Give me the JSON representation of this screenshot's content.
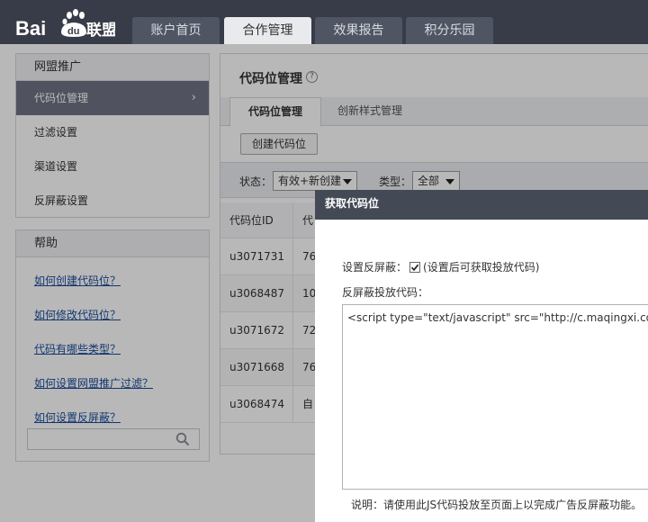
{
  "header": {
    "logo_alt": "Baidu联盟",
    "nav_tabs": [
      {
        "label": "账户首页",
        "active": false
      },
      {
        "label": "合作管理",
        "active": true
      },
      {
        "label": "效果报告",
        "active": false
      },
      {
        "label": "积分乐园",
        "active": false
      }
    ]
  },
  "sidebar": {
    "promo": {
      "heading": "网盟推广",
      "items": [
        {
          "label": "代码位管理",
          "active": true
        },
        {
          "label": "过滤设置",
          "active": false
        },
        {
          "label": "渠道设置",
          "active": false
        },
        {
          "label": "反屏蔽设置",
          "active": false
        }
      ]
    },
    "help": {
      "heading": "帮助",
      "links": [
        "如何创建代码位？",
        "如何修改代码位？",
        "代码有哪些类型？",
        "如何设置网盟推广过滤？",
        "如何设置反屏蔽？"
      ],
      "search_placeholder": ""
    }
  },
  "main": {
    "title": "代码位管理",
    "help_mark": "?",
    "tabs": [
      {
        "label": "代码位管理",
        "active": true
      },
      {
        "label": "创新样式管理",
        "active": false
      }
    ],
    "create_button": "创建代码位",
    "filters": {
      "status_label": "状态：",
      "status_value": "有效+新创建",
      "type_label": "类型：",
      "type_value": "全部"
    },
    "table": {
      "headers": [
        "代码位ID",
        "代"
      ],
      "rows": [
        [
          "u3071731",
          "76"
        ],
        [
          "u3068487",
          "10"
        ],
        [
          "u3071672",
          "72"
        ],
        [
          "u3071668",
          "76"
        ],
        [
          "u3068474",
          "自"
        ]
      ]
    }
  },
  "modal": {
    "title": "获取代码位",
    "protect_label": "设置反屏蔽：",
    "protect_checked": true,
    "protect_hint": "(设置后可获取投放代码)",
    "code_label": "反屏蔽投放代码：",
    "code": "<script type=\"text/javascript\" src=\"http://c.maqingxi.com/av",
    "note": "说明：请使用此JS代码投放至页面上以完成广告反屏蔽功能。"
  },
  "colors": {
    "header_bg": "#383c48",
    "nav_tab_bg": "#505563",
    "sidebar_active_bg": "#6f7484",
    "modal_title_bg": "#444956",
    "link": "#1a4c9c"
  }
}
